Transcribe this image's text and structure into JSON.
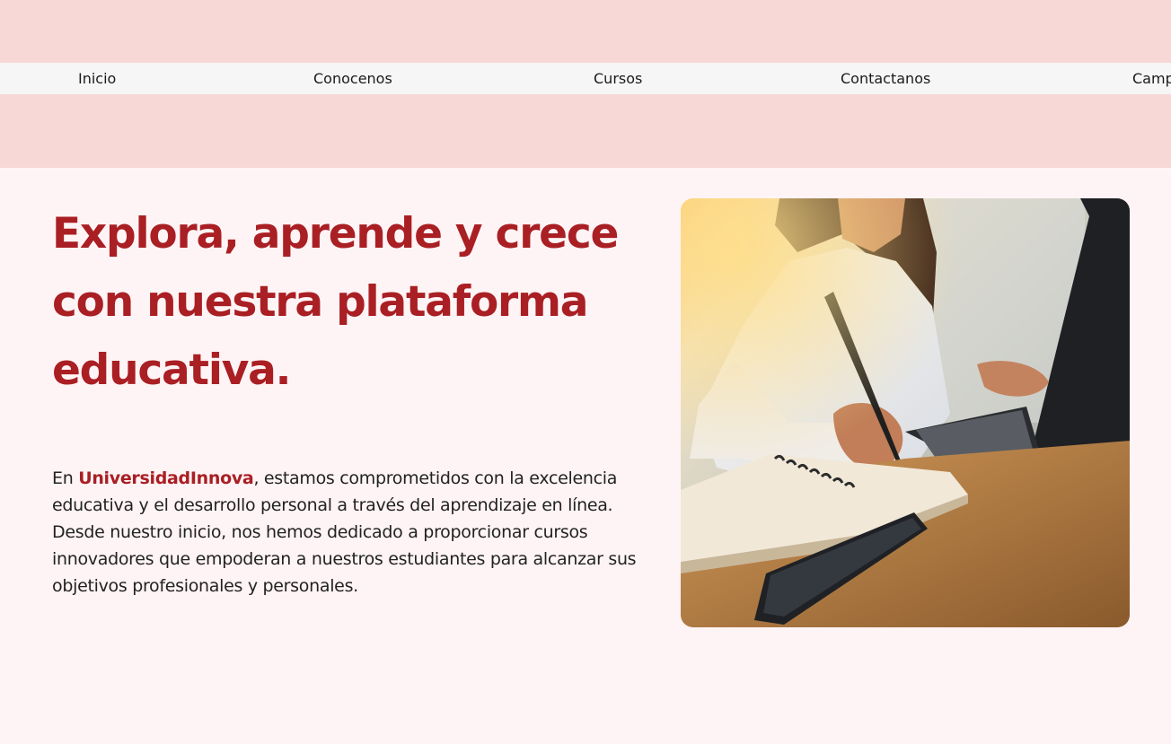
{
  "nav": {
    "items": [
      {
        "label": "Inicio"
      },
      {
        "label": "Conocenos"
      },
      {
        "label": "Cursos"
      },
      {
        "label": "Contactanos"
      },
      {
        "label": "Campus"
      }
    ]
  },
  "hero": {
    "title": "Explora, aprende y crece con nuestra plataforma educativa.",
    "intro_prefix": "En ",
    "brand": "UniversidadInnova",
    "intro_body": ", estamos comprometidos con la excelencia educativa y el desarrollo personal a través del aprendizaje en línea. Desde nuestro inicio, nos hemos dedicado a proporcionar cursos innovadores que empoderan a nuestros estudiantes para alcanzar sus objetivos profesionales y personales.",
    "image_subject": "woman-writing-notebook-with-laptop-photo"
  },
  "colors": {
    "accent": "#a91f24",
    "header_band": "#f8d7d7",
    "nav_bar": "#f6f6f6",
    "page_bg": "#fff4f5"
  }
}
